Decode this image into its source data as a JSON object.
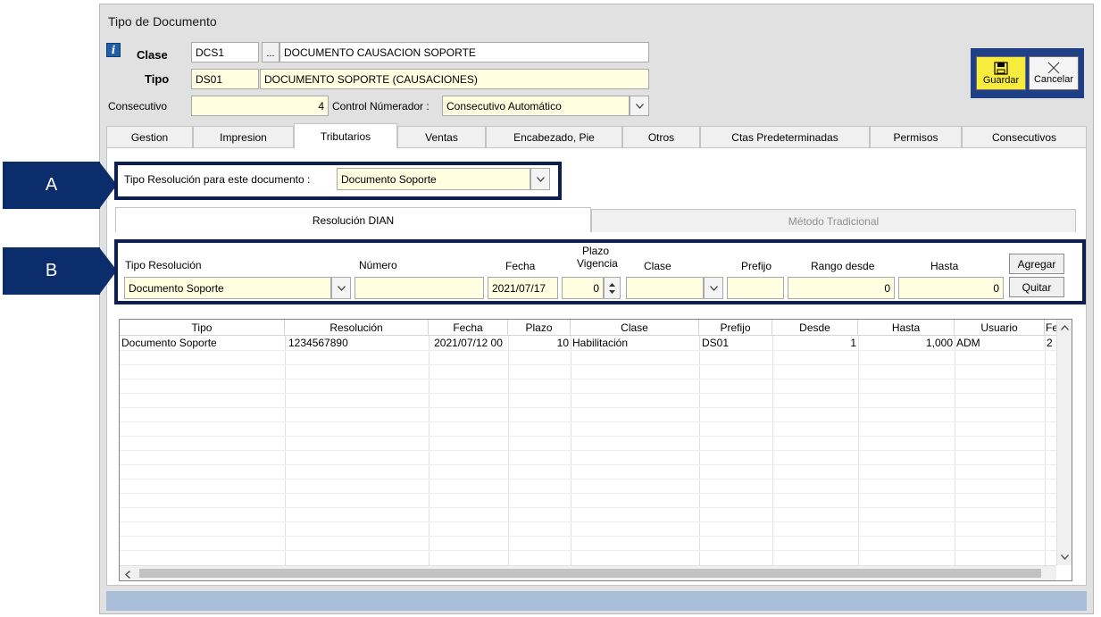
{
  "window": {
    "title": "Tipo de Documento"
  },
  "header": {
    "clase_label": "Clase",
    "clase_code": "DCS1",
    "clase_ellipsis": "...",
    "clase_desc": "DOCUMENTO CAUSACION SOPORTE",
    "tipo_label": "Tipo",
    "tipo_code": "DS01",
    "tipo_desc": "DOCUMENTO SOPORTE (CAUSACIONES)",
    "consecutivo_label": "Consecutivo",
    "consecutivo_value": "4",
    "control_label": "Control Númerador :",
    "control_value": "Consecutivo Automático"
  },
  "toolbar": {
    "guardar_label": "Guardar",
    "cancelar_label": "Cancelar"
  },
  "tabs": [
    {
      "label": "Gestion"
    },
    {
      "label": "Impresion"
    },
    {
      "label": "Tributarios"
    },
    {
      "label": "Ventas"
    },
    {
      "label": "Encabezado, Pie"
    },
    {
      "label": "Otros"
    },
    {
      "label": "Ctas Predeterminadas"
    },
    {
      "label": "Permisos"
    },
    {
      "label": "Consecutivos"
    }
  ],
  "markers": {
    "a": "A",
    "b": "B"
  },
  "resolucion_tipo": {
    "label": "Tipo Resolución para este documento  :",
    "value": "Documento Soporte"
  },
  "subtabs": [
    {
      "label": "Resolución DIAN"
    },
    {
      "label": "Método Tradicional"
    }
  ],
  "form": {
    "tipo_label": "Tipo Resolución",
    "tipo_value": "Documento Soporte",
    "numero_label": "Número",
    "numero_value": "",
    "fecha_label": "Fecha",
    "fecha_value": "2021/07/17",
    "plazo_label_1": "Plazo",
    "plazo_label_2": "Vigencia",
    "plazo_value": "0",
    "clase_label": "Clase",
    "clase_value": "",
    "prefijo_label": "Prefijo",
    "prefijo_value": "",
    "rango_label": "Rango desde",
    "rango_value": "0",
    "hasta_label": "Hasta",
    "hasta_value": "0",
    "agregar_label": "Agregar",
    "quitar_label": "Quitar"
  },
  "grid": {
    "headers": [
      "Tipo",
      "Resolución",
      "Fecha",
      "Plazo",
      "Clase",
      "Prefijo",
      "Desde",
      "Hasta",
      "Usuario",
      "Fe"
    ],
    "rows": [
      {
        "tipo": "Documento Soporte",
        "resolucion": "1234567890",
        "fecha": "2021/07/12 00",
        "plazo": "10",
        "clase": "Habilitación",
        "prefijo": "DS01",
        "desde": "1",
        "hasta": "1,000",
        "usuario": "ADM",
        "fe": "2"
      }
    ]
  },
  "colors": {
    "accent": "#0c2d6b",
    "field_bg": "#fffee1",
    "status_bar": "#a9bfd9"
  }
}
